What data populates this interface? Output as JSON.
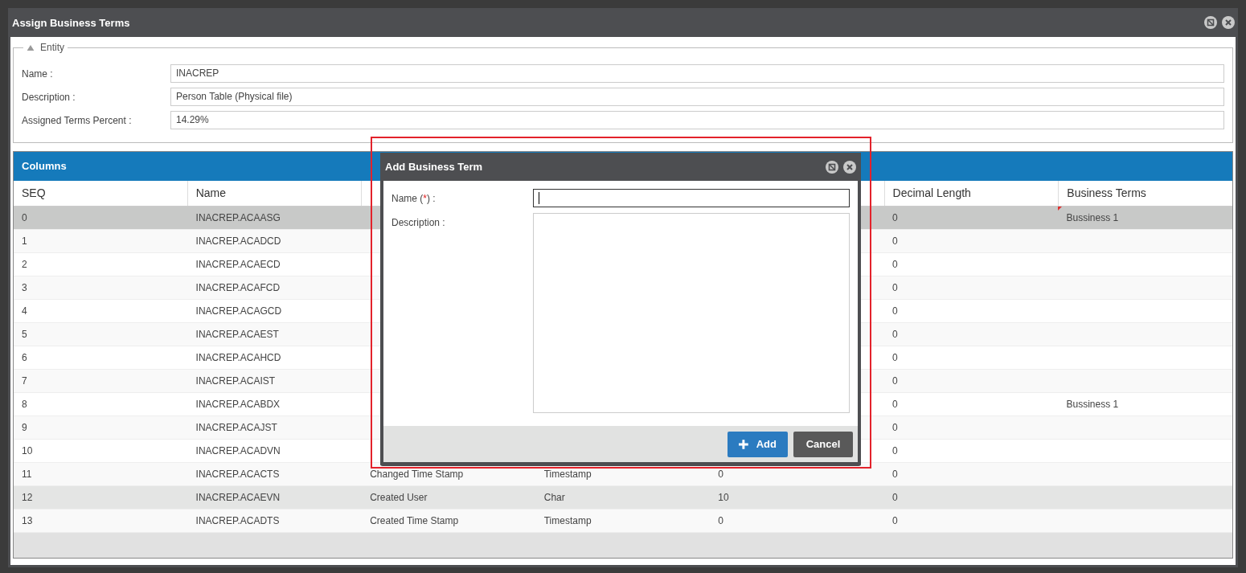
{
  "window": {
    "title": "Assign Business Terms"
  },
  "entity": {
    "legend": "Entity",
    "expanded": true,
    "fields": [
      {
        "label": "Name :",
        "value": "INACREP"
      },
      {
        "label": "Description :",
        "value": "Person Table (Physical file)"
      },
      {
        "label": "Assigned Terms Percent :",
        "value": "14.29%"
      }
    ]
  },
  "columns_panel": {
    "title": "Columns",
    "columns": [
      "SEQ",
      "Name",
      null,
      null,
      null,
      "Decimal Length",
      "Business Terms"
    ],
    "rows": [
      {
        "selected": true,
        "hovered": false,
        "modified": true,
        "cells": [
          "0",
          "INACREP.ACAASG",
          null,
          null,
          null,
          "0",
          "Bussiness 1"
        ]
      },
      {
        "selected": false,
        "hovered": false,
        "modified": false,
        "cells": [
          "1",
          "INACREP.ACADCD",
          null,
          null,
          null,
          "0",
          null
        ]
      },
      {
        "selected": false,
        "hovered": false,
        "modified": false,
        "cells": [
          "2",
          "INACREP.ACAECD",
          null,
          null,
          null,
          "0",
          null
        ]
      },
      {
        "selected": false,
        "hovered": false,
        "modified": false,
        "cells": [
          "3",
          "INACREP.ACAFCD",
          null,
          null,
          null,
          "0",
          null
        ]
      },
      {
        "selected": false,
        "hovered": false,
        "modified": false,
        "cells": [
          "4",
          "INACREP.ACAGCD",
          null,
          null,
          null,
          "0",
          null
        ]
      },
      {
        "selected": false,
        "hovered": false,
        "modified": false,
        "cells": [
          "5",
          "INACREP.ACAEST",
          null,
          null,
          null,
          "0",
          null
        ]
      },
      {
        "selected": false,
        "hovered": false,
        "modified": false,
        "cells": [
          "6",
          "INACREP.ACAHCD",
          null,
          null,
          null,
          "0",
          null
        ]
      },
      {
        "selected": false,
        "hovered": false,
        "modified": false,
        "cells": [
          "7",
          "INACREP.ACAIST",
          null,
          null,
          null,
          "0",
          null
        ]
      },
      {
        "selected": false,
        "hovered": false,
        "modified": false,
        "cells": [
          "8",
          "INACREP.ACABDX",
          null,
          null,
          null,
          "0",
          "Bussiness 1"
        ]
      },
      {
        "selected": false,
        "hovered": false,
        "modified": false,
        "cells": [
          "9",
          "INACREP.ACAJST",
          null,
          null,
          null,
          "0",
          null
        ]
      },
      {
        "selected": false,
        "hovered": false,
        "modified": false,
        "cells": [
          "10",
          "INACREP.ACADVN",
          null,
          null,
          null,
          "0",
          null
        ]
      },
      {
        "selected": false,
        "hovered": false,
        "modified": false,
        "cells": [
          "11",
          "INACREP.ACACTS",
          "Changed Time Stamp",
          "Timestamp",
          "0",
          "0",
          null
        ]
      },
      {
        "selected": false,
        "hovered": true,
        "modified": false,
        "cells": [
          "12",
          "INACREP.ACAEVN",
          "Created User",
          "Char",
          "10",
          "0",
          null
        ]
      },
      {
        "selected": false,
        "hovered": false,
        "modified": false,
        "cells": [
          "13",
          "INACREP.ACADTS",
          "Created Time Stamp",
          "Timestamp",
          "0",
          "0",
          null
        ]
      }
    ]
  },
  "dialog": {
    "title": "Add Business Term",
    "fields": [
      {
        "kind": "input",
        "label": "Name (",
        "required_mark": "*",
        "label_end": ") :",
        "focused": true
      },
      {
        "kind": "textarea",
        "label": "Description :",
        "focused": false
      }
    ],
    "buttons": [
      {
        "kind": "primary",
        "label": "Add"
      },
      {
        "kind": "secondary",
        "label": "Cancel"
      }
    ]
  }
}
